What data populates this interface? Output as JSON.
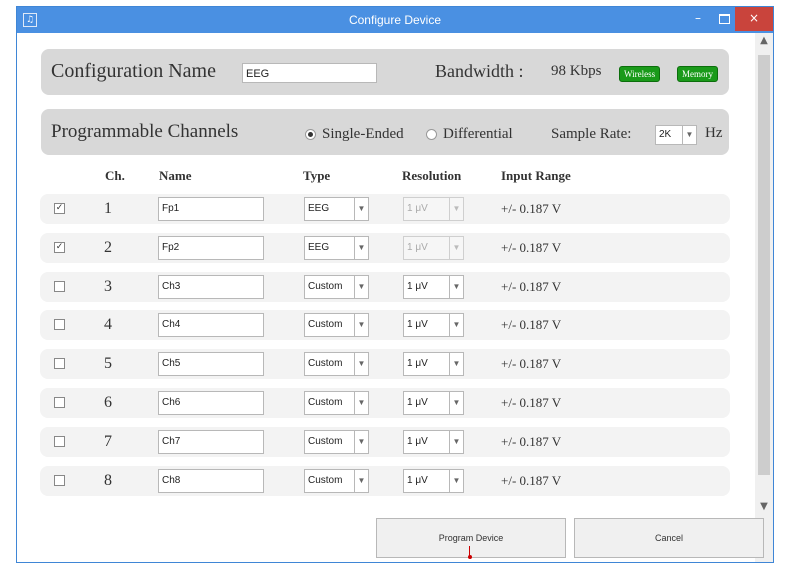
{
  "window": {
    "title": "Configure Device",
    "app_icon": "app-icon"
  },
  "controls": {
    "minimize": "–",
    "close": "×"
  },
  "config": {
    "label": "Configuration Name",
    "name_value": "EEG",
    "bandwidth_label": "Bandwidth :",
    "bandwidth_value": "98 Kbps",
    "badges": {
      "wireless": "Wireless",
      "memory": "Memory"
    },
    "badge_color": "#1a9a1a"
  },
  "channels_panel": {
    "label": "Programmable Channels",
    "mode_single": "Single-Ended",
    "mode_differential": "Differential",
    "selected_mode": "Single-Ended",
    "sample_rate_label": "Sample Rate:",
    "sample_rate_value": "2K",
    "sample_rate_unit": "Hz"
  },
  "columns": {
    "ch": "Ch.",
    "name": "Name",
    "type": "Type",
    "resolution": "Resolution",
    "input_range": "Input Range"
  },
  "rows": [
    {
      "checked": "✓",
      "ch": "1",
      "name": "Fp1",
      "type": "EEG",
      "resolution": "1 μV",
      "range": "+/- 0.187 V"
    },
    {
      "checked": "✓",
      "ch": "2",
      "name": "Fp2",
      "type": "EEG",
      "resolution": "1 μV",
      "range": "+/- 0.187 V"
    },
    {
      "checked": "",
      "ch": "3",
      "name": "Ch3",
      "type": "Custom",
      "resolution": "1 μV",
      "range": "+/- 0.187 V"
    },
    {
      "checked": "",
      "ch": "4",
      "name": "Ch4",
      "type": "Custom",
      "resolution": "1 μV",
      "range": "+/- 0.187 V"
    },
    {
      "checked": "",
      "ch": "5",
      "name": "Ch5",
      "type": "Custom",
      "resolution": "1 μV",
      "range": "+/- 0.187 V"
    },
    {
      "checked": "",
      "ch": "6",
      "name": "Ch6",
      "type": "Custom",
      "resolution": "1 μV",
      "range": "+/- 0.187 V"
    },
    {
      "checked": "",
      "ch": "7",
      "name": "Ch7",
      "type": "Custom",
      "resolution": "1 μV",
      "range": "+/- 0.187 V"
    },
    {
      "checked": "",
      "ch": "8",
      "name": "Ch8",
      "type": "Custom",
      "resolution": "1 μV",
      "range": "+/- 0.187 V"
    }
  ],
  "buttons": {
    "program": "Program Device",
    "cancel": "Cancel"
  },
  "colors": {
    "titlebar": "#4a90e2",
    "close": "#c9443c"
  }
}
